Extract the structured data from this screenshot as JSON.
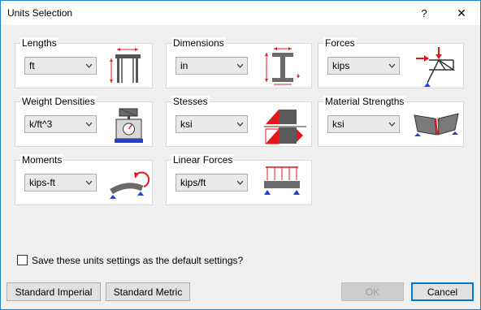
{
  "window": {
    "title": "Units Selection",
    "help_glyph": "?",
    "close_glyph": "✕"
  },
  "groups": {
    "lengths": {
      "label": "Lengths",
      "value": "ft"
    },
    "dimensions": {
      "label": "Dimensions",
      "value": "in"
    },
    "forces": {
      "label": "Forces",
      "value": "kips"
    },
    "weight_densities": {
      "label": "Weight Densities",
      "value": "k/ft^3"
    },
    "stresses": {
      "label": "Stesses",
      "value": "ksi"
    },
    "material_strengths": {
      "label": "Material Strengths",
      "value": "ksi"
    },
    "moments": {
      "label": "Moments",
      "value": "kips-ft"
    },
    "linear_forces": {
      "label": "Linear Forces",
      "value": "kips/ft"
    }
  },
  "default_checkbox": {
    "label": "Save these units settings as the default settings?",
    "checked": false
  },
  "buttons": {
    "standard_imperial": "Standard Imperial",
    "standard_metric": "Standard Metric",
    "ok": "OK",
    "cancel": "Cancel"
  },
  "icons": {
    "lengths": "frame-span-icon",
    "dimensions": "i-beam-section-icon",
    "forces": "truss-load-icon",
    "weight_densities": "scale-weight-icon",
    "stresses": "stress-diagram-icon",
    "material_strengths": "fractured-beam-icon",
    "moments": "bending-moment-icon",
    "linear_forces": "distributed-load-icon"
  },
  "colors": {
    "accent": "#0078d7",
    "dimension_red": "#e8141c",
    "support_blue": "#1f3fd8",
    "steel_gray": "#5a5a5a"
  }
}
